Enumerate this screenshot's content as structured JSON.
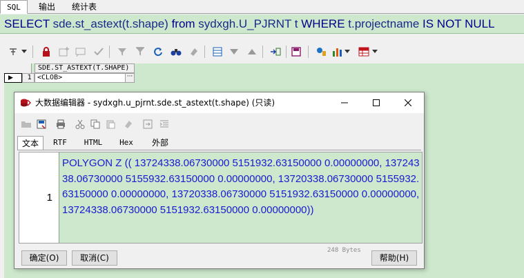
{
  "tabs": [
    "SQL",
    "输出",
    "统计表"
  ],
  "sql": {
    "select": "SELECT",
    "func": "sde.st_astext(t.shape)",
    "from": "from",
    "table": "sydxgh.U_PJRNT t",
    "where": "WHERE",
    "col": "t.projectname",
    "isnotnull": "IS NOT NULL"
  },
  "grid": {
    "column": "SDE.ST_ASTEXT(T.SHAPE)",
    "row_number": "1",
    "row_marker": "▶",
    "cell_value": "<CLOB>",
    "cell_button": "···"
  },
  "dialog": {
    "title": "大数据编辑器 - sydxgh.u_pjrnt.sde.st_astext(t.shape) (只读)",
    "tabs": [
      "文本",
      "RTF",
      "HTML",
      "Hex",
      "外部"
    ],
    "line_number": "1",
    "content": "POLYGON Z (( 13724338.06730000 5151932.63150000 0.00000000, 13724338.06730000 5155932.63150000 0.00000000, 13720338.06730000 5155932.63150000 0.00000000, 13720338.06730000 5151932.63150000 0.00000000, 13724338.06730000 5151932.63150000 0.00000000))",
    "size": "248 Bytes",
    "ok_label": "确定(O)",
    "cancel_label": "取消(C)",
    "help_label": "帮助(H)"
  },
  "colors": {
    "editor_bg": "#cde8cd",
    "keyword": "#00008b",
    "content_text": "#1a1ad0"
  }
}
